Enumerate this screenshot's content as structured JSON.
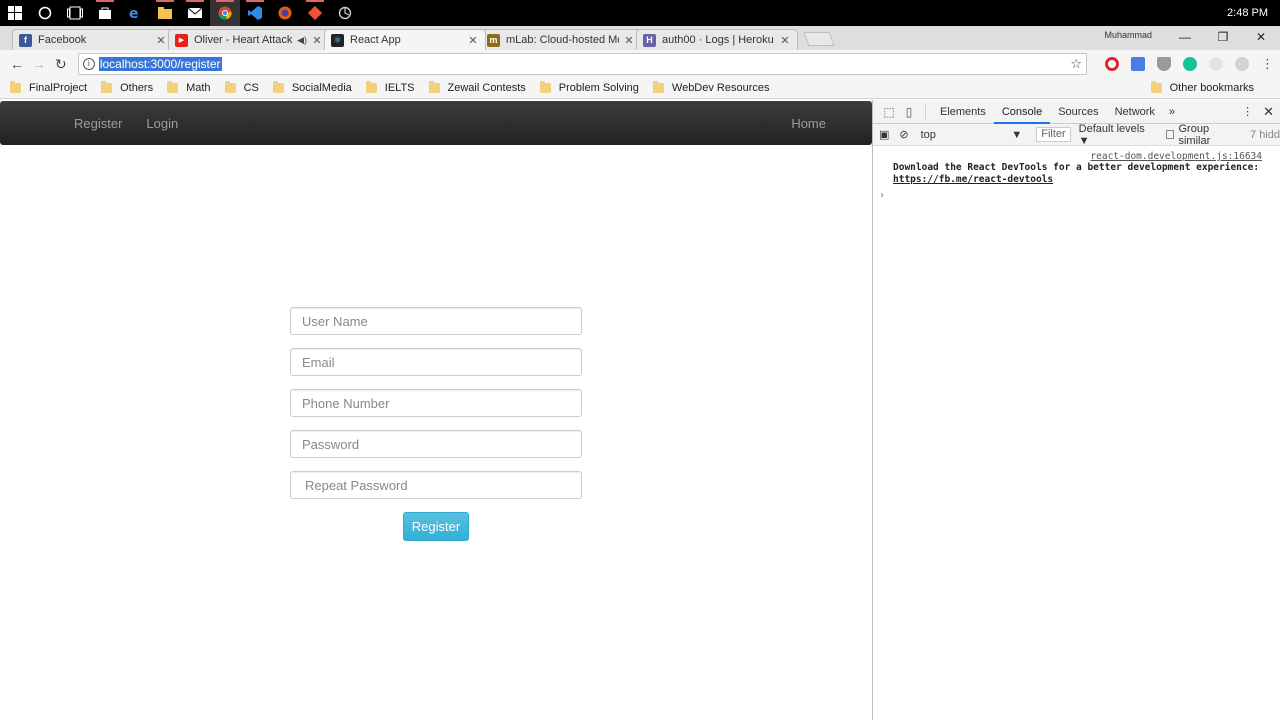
{
  "taskbar": {
    "clock": "2:48 PM",
    "icons": [
      "windows-start-icon",
      "cortana-icon",
      "task-view-icon",
      "store-icon",
      "edge-icon",
      "file-explorer-icon",
      "mail-icon",
      "chrome-icon",
      "vscode-icon",
      "firefox-icon",
      "git-icon",
      "app-icon"
    ]
  },
  "tabs": [
    {
      "title": "Facebook",
      "icon_color": "#3b5998",
      "icon_glyph": "f"
    },
    {
      "title": "Oliver - Heart Attack (",
      "icon_color": "#e62117",
      "icon_glyph": "▶"
    },
    {
      "title": "React App",
      "icon_color": "#222222",
      "icon_glyph": "⚛"
    },
    {
      "title": "mLab: Cloud-hosted Mo",
      "icon_color": "#8a6d1c",
      "icon_glyph": "m"
    },
    {
      "title": "auth00 · Logs | Heroku",
      "icon_color": "#6762a6",
      "icon_glyph": "H"
    }
  ],
  "window": {
    "user": "Muhammad"
  },
  "address": {
    "url": "localhost:3000/register"
  },
  "bookmarks": [
    "FinalProject",
    "Others",
    "Math",
    "CS",
    "SocialMedia",
    "IELTS",
    "Zewail Contests",
    "Problem Solving",
    "WebDev Resources"
  ],
  "other_bookmarks": "Other bookmarks",
  "navbar": {
    "register": "Register",
    "login": "Login",
    "home": "Home"
  },
  "form": {
    "username_placeholder": "User Name",
    "email_placeholder": "Email",
    "phone_placeholder": "Phone Number",
    "password_placeholder": "Password",
    "repeat_placeholder": "Repeat Password",
    "submit_label": "Register"
  },
  "devtools": {
    "tabs": [
      "Elements",
      "Console",
      "Sources",
      "Network"
    ],
    "active_tab": "Console",
    "context": "top",
    "filter": "Filter",
    "levels": "Default levels ▼",
    "group_similar": "Group similar",
    "hidden": "7 hidd",
    "log_source": "react-dom.development.js:16634",
    "log_message": "Download the React DevTools for a better development experience: ",
    "log_link": "https://fb.me/react-devtools"
  },
  "colors": {
    "accent_button": "#5bc0de",
    "navbar": "#222222",
    "selection": "#3875d7"
  }
}
